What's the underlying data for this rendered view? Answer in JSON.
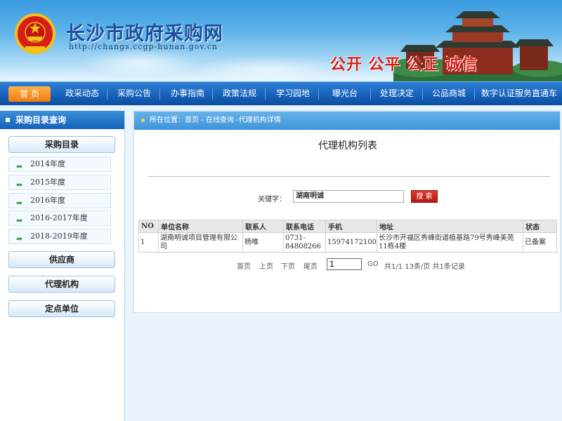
{
  "header": {
    "title": "长沙市政府采购网",
    "url": "http://changs.ccgp-hunan.gov.cn",
    "slogan": "公开 公平 公正 诚信"
  },
  "nav": [
    {
      "label": "首 页",
      "active": true
    },
    {
      "label": "政采动态"
    },
    {
      "label": "采购公告"
    },
    {
      "label": "办事指南"
    },
    {
      "label": "政策法规"
    },
    {
      "label": "学习园地"
    },
    {
      "label": "曝光台"
    },
    {
      "label": "处理决定"
    },
    {
      "label": "公品商城"
    },
    {
      "label": "数字认证服务直通车"
    }
  ],
  "sidebar": {
    "header": "采购目录查询",
    "catalog_button": "采购目录",
    "years": [
      "2014年度",
      "2015年度",
      "2016年度",
      "2016-2017年度",
      "2018-2019年度"
    ],
    "supplier_button": "供应商",
    "agency_button": "代理机构",
    "fixed_button": "定点单位"
  },
  "main": {
    "breadcrumb": "所在位置：首页  - 在线查询  -代理机构详情",
    "title": "代理机构列表",
    "keyword_label": "关键字：",
    "keyword_value": "湖南明诚",
    "search_button": "搜 索",
    "table": {
      "headers": [
        "NO",
        "单位名称",
        "联系人",
        "联系电话",
        "手机",
        "地址",
        "状态"
      ],
      "rows": [
        [
          "1",
          "湖南明诚项目管理有限公司",
          "杨唯",
          "0731-84808266",
          "15974172100",
          "长沙市开福区秀峰街道植基路79号秀峰美苑11栋4楼",
          "已备案"
        ]
      ]
    },
    "pager": {
      "first": "首页",
      "prev": "上页",
      "next": "下页",
      "last": "尾页",
      "page_value": "1",
      "go": "GO",
      "summary": "共1/1 13条/页 共1条记录"
    }
  },
  "colors": {
    "nav_bg": "#1560b8",
    "nav_active": "#f17a0e",
    "slogan": "#d51e17",
    "title_blue": "#1a4f9c",
    "search_button": "#c4221a"
  }
}
